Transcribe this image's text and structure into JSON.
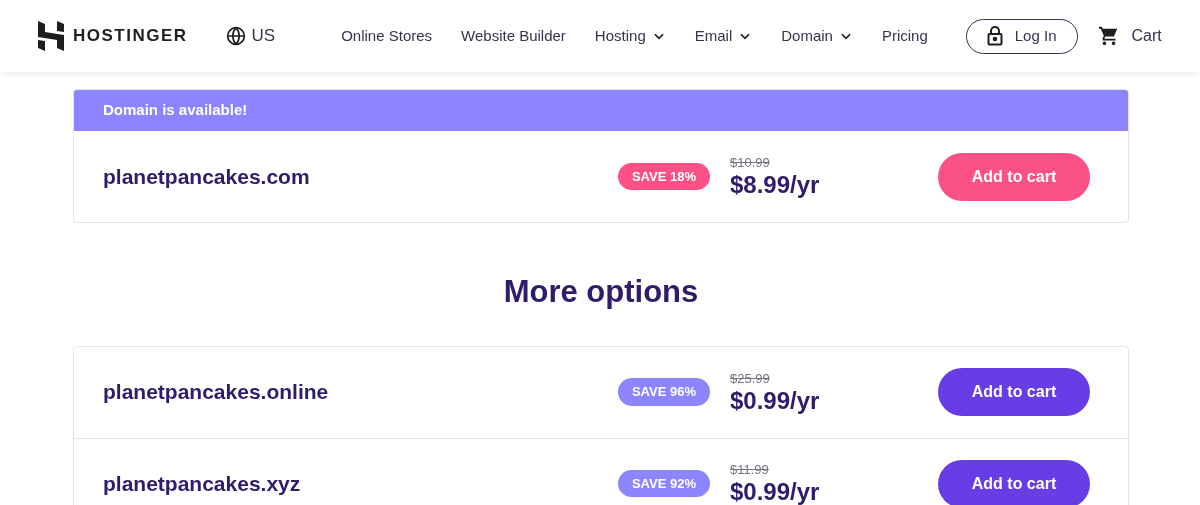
{
  "header": {
    "brand": "HOSTINGER",
    "region": "US",
    "nav": [
      {
        "label": "Online Stores",
        "has_menu": false
      },
      {
        "label": "Website Builder",
        "has_menu": false
      },
      {
        "label": "Hosting",
        "has_menu": true
      },
      {
        "label": "Email",
        "has_menu": true
      },
      {
        "label": "Domain",
        "has_menu": true
      },
      {
        "label": "Pricing",
        "has_menu": false
      }
    ],
    "login": "Log In",
    "cart": "Cart"
  },
  "result": {
    "banner": "Domain is available!",
    "domain": "planetpancakes.com",
    "save": "SAVE 18%",
    "old_price": "$10.99",
    "price": "$8.99/yr",
    "button": "Add to cart"
  },
  "more_options": {
    "title": "More options",
    "items": [
      {
        "domain": "planetpancakes.online",
        "save": "SAVE 96%",
        "old_price": "$25.99",
        "price": "$0.99/yr",
        "button": "Add to cart"
      },
      {
        "domain": "planetpancakes.xyz",
        "save": "SAVE 92%",
        "old_price": "$11.99",
        "price": "$0.99/yr",
        "button": "Add to cart"
      }
    ]
  }
}
